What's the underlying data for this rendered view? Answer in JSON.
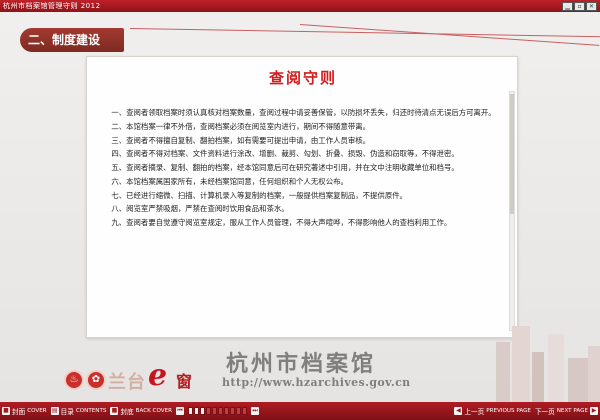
{
  "window": {
    "title": "杭州市档案馆管理守则 2012",
    "minimize_glyph": "▁",
    "restore_glyph": "▫",
    "close_glyph": "✕"
  },
  "section": {
    "heading": "二、制度建设"
  },
  "document": {
    "title": "查阅守则",
    "paragraphs": [
      "一、查阅者领取档案时须认真核对档案数量，查阅过程中请妥善保管，以防损坏丢失，归还时待清点无误后方可离开。",
      "二、本馆档案一律不外借，查阅档案必须在阅览室内进行，期间不得随意带离。",
      "三、查阅者不得擅自复制、翻拍档案，如有需要可提出申请，由工作人员审核。",
      "四、查阅者不得对档案、文件资料进行涂改、增删、裁剪、勾划、折叠、损毁、伪造和窃取等，不得泄密。",
      "五、查阅者摘录、复制、翻拍的档案，经本馆同意后可在研究著述中引用，并在文中注明收藏单位和档号。",
      "六、本馆档案属国家所有，未经档案馆同意，任何组织和个人无权公布。",
      "七、已经进行缩微、扫描、计算机录入等复制的档案，一般提供档案复制品，不提供原件。",
      "八、阅览室严禁吸烟，严禁在查阅时饮用食品和茶水。",
      "九、查阅者要自觉遵守阅览室规定，服从工作人员管理，不得大声喧哗，不得影响他人的查档利用工作。"
    ]
  },
  "branding": {
    "logo_glyph_1": "♨",
    "logo_glyph_2": "✿",
    "lantai": "兰台",
    "e": "e",
    "chuang": "窗",
    "archive_name": "杭州市档案馆",
    "archive_url": "http://www.hzarchives.gov.cn"
  },
  "toolbar": {
    "cover": {
      "cn": "封面",
      "en": "COVER",
      "icon": "■"
    },
    "contents": {
      "cn": "目录",
      "en": "CONTENTS",
      "icon": "▤"
    },
    "back_cover": {
      "cn": "封底",
      "en": "BACK COVER",
      "icon": "■"
    },
    "first": {
      "icon": "⏮"
    },
    "progress": {
      "total": 10,
      "current": 3
    },
    "last": {
      "icon": "⏭"
    },
    "previous": {
      "cn": "上一页",
      "en": "PREVIOUS PAGE",
      "icon": "◀"
    },
    "next": {
      "cn": "下一页",
      "en": "NEXT PAGE",
      "icon": "▶"
    }
  },
  "colors": {
    "accent": "#c0212a",
    "section_tab": "#8f3228",
    "doc_title": "#d21d1d"
  }
}
